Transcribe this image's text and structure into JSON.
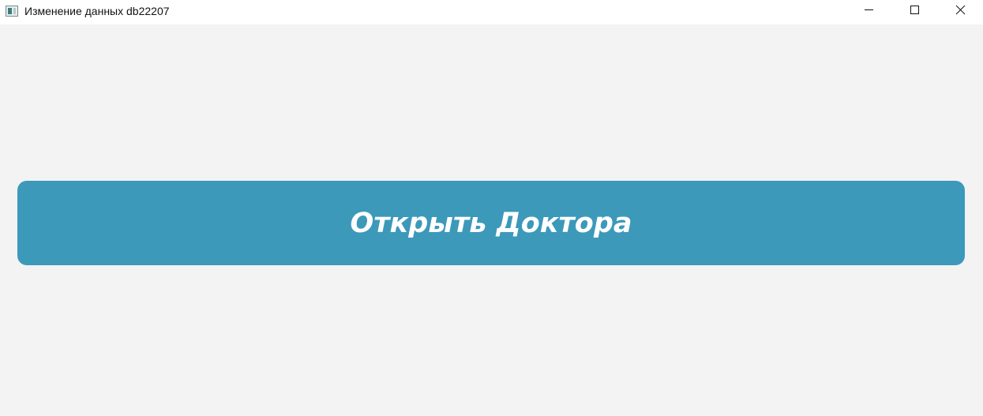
{
  "window": {
    "title": "Изменение данных db22207",
    "icon": "app-window-icon",
    "controls": {
      "minimize_icon": "minimize-icon",
      "maximize_icon": "maximize-icon",
      "close_icon": "close-icon"
    }
  },
  "main": {
    "open_doctor_label": "Открыть Доктора"
  },
  "colors": {
    "background": "#f3f3f3",
    "titlebar": "#ffffff",
    "button": "#3c99ba",
    "button_text": "#ffffff"
  }
}
